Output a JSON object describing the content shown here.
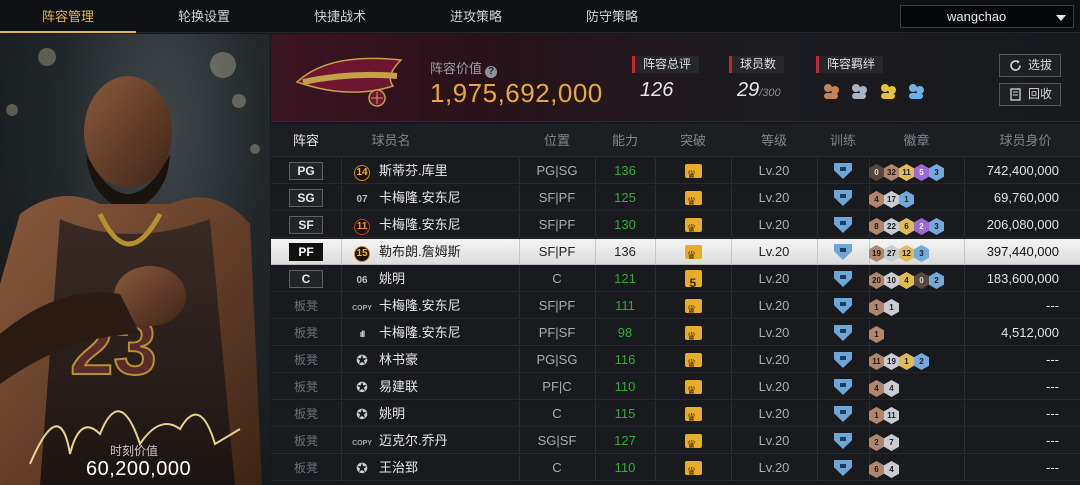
{
  "nav": {
    "tabs": [
      {
        "label": "阵容管理",
        "active": true
      },
      {
        "label": "轮换设置",
        "active": false
      },
      {
        "label": "快捷战术",
        "active": false
      },
      {
        "label": "进攻策略",
        "active": false
      },
      {
        "label": "防守策略",
        "active": false
      }
    ],
    "user": "wangchao"
  },
  "player_card": {
    "jersey": "23",
    "value_label": "时刻价值",
    "value": "60,200,000"
  },
  "team": {
    "value_label": "阵容价值",
    "value": "1,975,692,000",
    "rating_label": "阵容总评",
    "rating": "126",
    "count_label": "球员数",
    "count": "29",
    "count_max": "/300",
    "bond_label": "阵容羁绊",
    "select_button": "选拔",
    "recycle_button": "回收",
    "colors": {
      "accent": "#e6b84a",
      "value": "#e6a93d",
      "marker": "#c0282f"
    }
  },
  "table": {
    "headers": [
      "阵容",
      "球员名",
      "位置",
      "能力",
      "突破",
      "等级",
      "训练",
      "徽章",
      "球员身价"
    ],
    "rows": [
      {
        "slot": "PG",
        "bench": false,
        "number": "14",
        "num_style": "gold",
        "name": "斯蒂芬.库里",
        "loc": "PG|SG",
        "ability": "136",
        "break": "crown",
        "level": "Lv.20",
        "badges": [
          [
            "0",
            "dark"
          ],
          [
            "32",
            "bronze"
          ],
          [
            "11",
            "gold"
          ],
          [
            "5",
            "purple"
          ],
          [
            "3",
            "blue"
          ]
        ],
        "salary": "742,400,000",
        "selected": false
      },
      {
        "slot": "SG",
        "bench": false,
        "number": "07",
        "num_style": "plain",
        "name": "卡梅隆.安东尼",
        "loc": "SF|PF",
        "ability": "125",
        "break": "crown",
        "level": "Lv.20",
        "badges": [
          [
            "4",
            "bronze"
          ],
          [
            "17",
            "silver"
          ],
          [
            "1",
            "blue"
          ]
        ],
        "salary": "69,760,000",
        "selected": false
      },
      {
        "slot": "SF",
        "bench": false,
        "number": "11",
        "num_style": "red",
        "name": "卡梅隆.安东尼",
        "loc": "SF|PF",
        "ability": "130",
        "break": "crown",
        "level": "Lv.20",
        "badges": [
          [
            "8",
            "bronze"
          ],
          [
            "22",
            "silver"
          ],
          [
            "6",
            "gold"
          ],
          [
            "2",
            "purple"
          ],
          [
            "3",
            "blue"
          ]
        ],
        "salary": "206,080,000",
        "selected": false
      },
      {
        "slot": "PF",
        "bench": false,
        "number": "15",
        "num_style": "gold",
        "name": "勒布朗.詹姆斯",
        "loc": "SF|PF",
        "ability": "136",
        "break": "crown",
        "level": "Lv.20",
        "badges": [
          [
            "19",
            "bronze"
          ],
          [
            "27",
            "silver"
          ],
          [
            "12",
            "gold"
          ],
          [
            "3",
            "blue"
          ]
        ],
        "salary": "397,440,000",
        "selected": true
      },
      {
        "slot": "C",
        "bench": false,
        "number": "06",
        "num_style": "plain",
        "name": "姚明",
        "loc": "C",
        "ability": "121",
        "break": "five",
        "level": "Lv.20",
        "badges": [
          [
            "20",
            "bronze"
          ],
          [
            "10",
            "silver"
          ],
          [
            "4",
            "gold"
          ],
          [
            "0",
            "dark"
          ],
          [
            "2",
            "blue"
          ]
        ],
        "salary": "183,600,000",
        "selected": false
      },
      {
        "slot": "板凳",
        "bench": true,
        "number": "COPY",
        "num_style": "text",
        "name": "卡梅隆.安东尼",
        "loc": "SF|PF",
        "ability": "111",
        "break": "crown",
        "level": "Lv.20",
        "badges": [
          [
            "1",
            "bronze"
          ],
          [
            "1",
            "silver"
          ]
        ],
        "salary": "---",
        "selected": false
      },
      {
        "slot": "板凳",
        "bench": true,
        "number": "ıll",
        "num_style": "bars",
        "name": "卡梅隆.安东尼",
        "loc": "PF|SF",
        "ability": "98",
        "break": "crown",
        "level": "Lv.20",
        "badges": [
          [
            "1",
            "bronze"
          ]
        ],
        "salary": "4,512,000",
        "selected": false
      },
      {
        "slot": "板凳",
        "bench": true,
        "number": "✪",
        "num_style": "star",
        "name": "林书豪",
        "loc": "PG|SG",
        "ability": "116",
        "break": "crown",
        "level": "Lv.20",
        "badges": [
          [
            "11",
            "bronze"
          ],
          [
            "19",
            "silver"
          ],
          [
            "1",
            "gold"
          ],
          [
            "2",
            "blue"
          ]
        ],
        "salary": "---",
        "selected": false
      },
      {
        "slot": "板凳",
        "bench": true,
        "number": "✪",
        "num_style": "star",
        "name": "易建联",
        "loc": "PF|C",
        "ability": "110",
        "break": "crown",
        "level": "Lv.20",
        "badges": [
          [
            "4",
            "bronze"
          ],
          [
            "4",
            "silver"
          ]
        ],
        "salary": "---",
        "selected": false
      },
      {
        "slot": "板凳",
        "bench": true,
        "number": "✪",
        "num_style": "star",
        "name": "姚明",
        "loc": "C",
        "ability": "115",
        "break": "crown",
        "level": "Lv.20",
        "badges": [
          [
            "1",
            "bronze"
          ],
          [
            "11",
            "silver"
          ]
        ],
        "salary": "---",
        "selected": false
      },
      {
        "slot": "板凳",
        "bench": true,
        "number": "COPY",
        "num_style": "text",
        "name": "迈克尔.乔丹",
        "loc": "SG|SF",
        "ability": "127",
        "break": "crown",
        "level": "Lv.20",
        "badges": [
          [
            "2",
            "bronze"
          ],
          [
            "7",
            "silver"
          ]
        ],
        "salary": "---",
        "selected": false
      },
      {
        "slot": "板凳",
        "bench": true,
        "number": "✪",
        "num_style": "star",
        "name": "王治郅",
        "loc": "C",
        "ability": "110",
        "break": "crown",
        "level": "Lv.20",
        "badges": [
          [
            "6",
            "bronze"
          ],
          [
            "4",
            "silver"
          ]
        ],
        "salary": "---",
        "selected": false
      }
    ]
  }
}
